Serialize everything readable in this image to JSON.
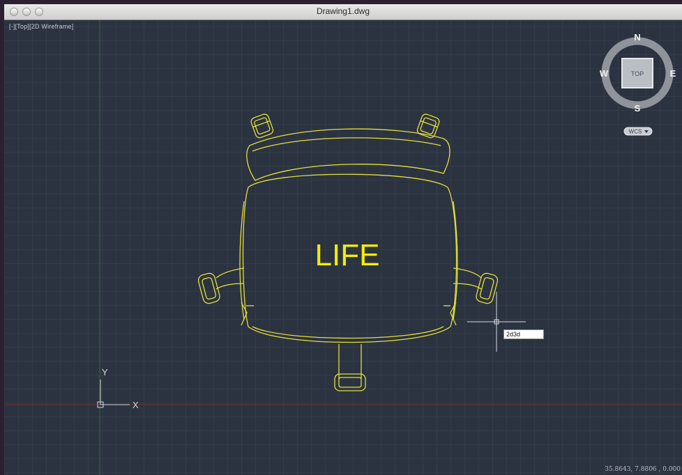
{
  "window": {
    "title": "Drawing1.dwg"
  },
  "viewport": {
    "label": "[-][Top][2D Wireframe]"
  },
  "viewcube": {
    "north": "N",
    "south": "S",
    "east": "E",
    "west": "W",
    "face": "TOP",
    "wcs_label": "WCS"
  },
  "ucs": {
    "x_label": "X",
    "y_label": "Y"
  },
  "drawing": {
    "text": "LIFE"
  },
  "dynamic_input": {
    "value": "2d3d"
  },
  "status": {
    "coordinates": "35.8643, 7.8806 , 0.000"
  },
  "colors": {
    "background": "#2c3340",
    "grid": "#3b4352",
    "linework": "#e3e03a",
    "x_axis": "#7a2a36",
    "y_axis": "#2f6b3a"
  }
}
